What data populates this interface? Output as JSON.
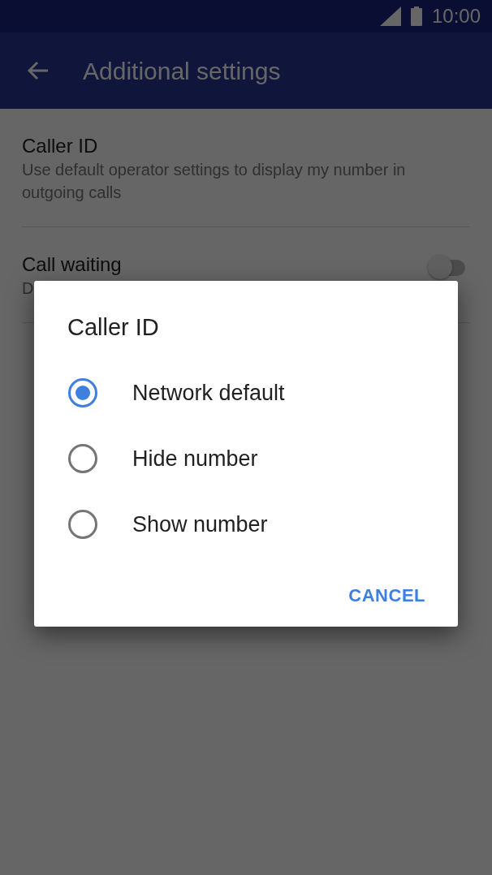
{
  "status_bar": {
    "time": "10:00"
  },
  "app_bar": {
    "title": "Additional settings"
  },
  "settings": [
    {
      "title": "Caller ID",
      "summary": "Use default operator settings to display my number in outgoing calls"
    },
    {
      "title": "Call waiting",
      "summary": "D",
      "switch": {
        "on": false
      }
    }
  ],
  "dialog": {
    "title": "Caller ID",
    "options": [
      {
        "label": "Network default",
        "selected": true
      },
      {
        "label": "Hide number",
        "selected": false
      },
      {
        "label": "Show number",
        "selected": false
      }
    ],
    "buttons": [
      "CANCEL"
    ]
  }
}
